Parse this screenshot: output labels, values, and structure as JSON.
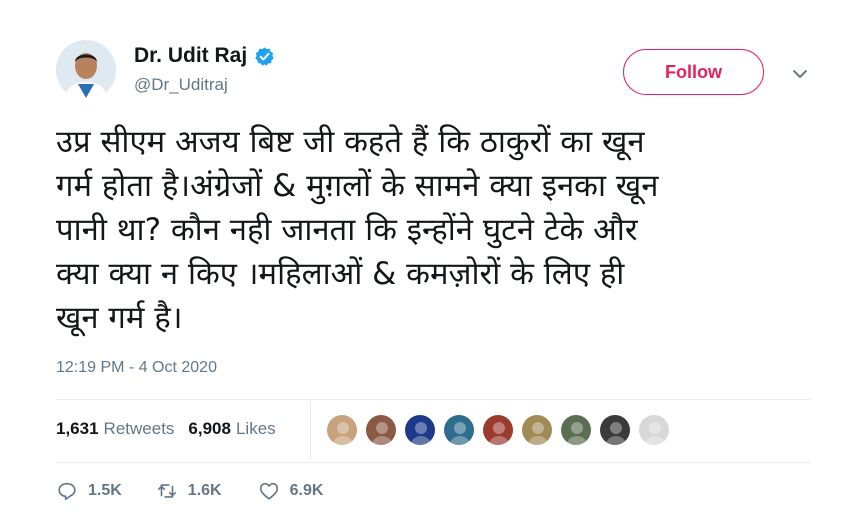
{
  "author": {
    "display_name": "Dr. Udit Raj",
    "handle": "@Dr_Uditraj",
    "avatar_icon": "user-avatar"
  },
  "follow_label": "Follow",
  "tweet": {
    "lines": [
      "उप्र सीएम अजय बिष्ट जी कहते हैं कि ठाकुरों का खून",
      "गर्म होता है।अंग्रेजों & मुग़लों के सामने क्या इनका खून",
      "पानी था? कौन नही जानता कि इन्होंने घुटने टेके और",
      "क्या क्या न किए ।महिलाओं & कमज़ोरों के लिए ही",
      "खून गर्म है।"
    ]
  },
  "timestamp": "12:19 PM - 4 Oct 2020",
  "stats": {
    "retweets_count": "1,631",
    "retweets_label": "Retweets",
    "likes_count": "6,908",
    "likes_label": "Likes"
  },
  "likers": [
    {
      "icon": "liker-avatar",
      "color": "#c7a27c"
    },
    {
      "icon": "liker-avatar",
      "color": "#8a5a44"
    },
    {
      "icon": "liker-avatar",
      "color": "#1d3a8a"
    },
    {
      "icon": "liker-avatar",
      "color": "#2f6d8c"
    },
    {
      "icon": "liker-avatar",
      "color": "#9b3b2e"
    },
    {
      "icon": "liker-avatar",
      "color": "#a08a55"
    },
    {
      "icon": "liker-avatar",
      "color": "#5b6e54"
    },
    {
      "icon": "liker-avatar",
      "color": "#3a3a3a"
    },
    {
      "icon": "liker-avatar",
      "color": "#d8d8d8"
    }
  ],
  "actions": {
    "reply_count": "1.5K",
    "retweet_count": "1.6K",
    "like_count": "6.9K"
  },
  "colors": {
    "accent": "#e0245e",
    "verified": "#1da1f2",
    "secondary_text": "#657786"
  }
}
